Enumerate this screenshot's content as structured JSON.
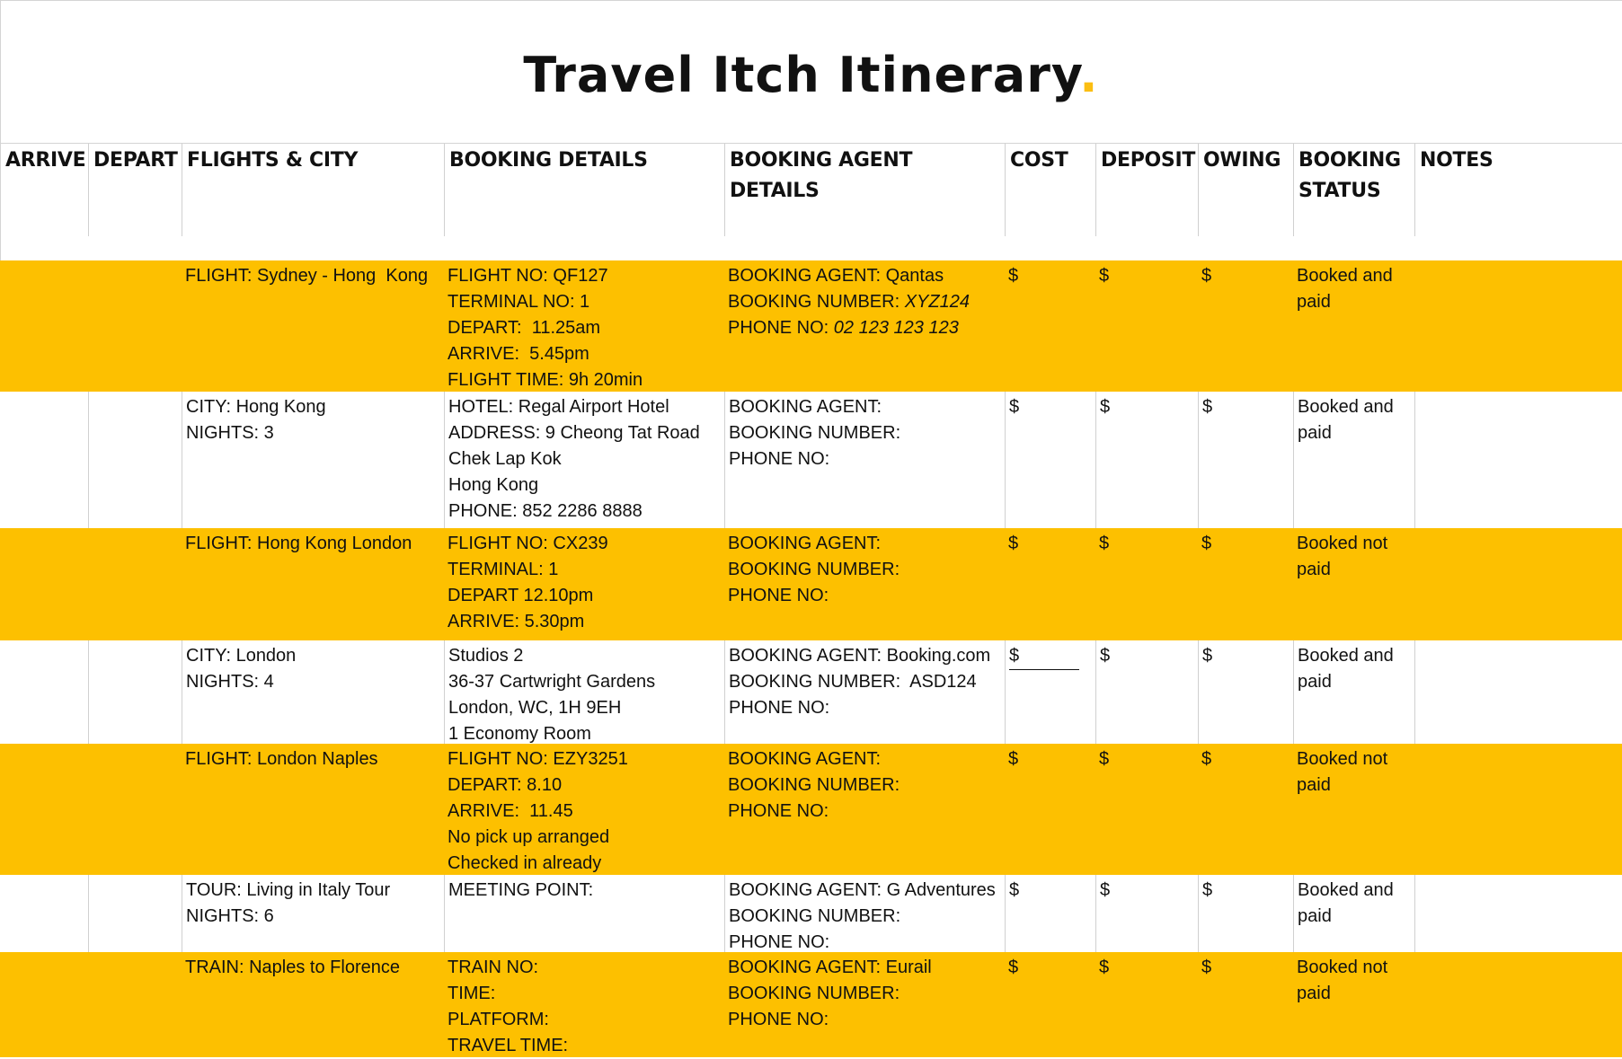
{
  "title": {
    "text": "Travel Itch Itinerary",
    "dot": ".",
    "dot_color": "#fbbe12"
  },
  "colors": {
    "row_highlight": "#fdc000",
    "grid": "#d0d0d0"
  },
  "headers": [
    {
      "key": "arrive",
      "lines": [
        "ARRIVE"
      ]
    },
    {
      "key": "depart",
      "lines": [
        "DEPART"
      ]
    },
    {
      "key": "flights_city",
      "lines": [
        "FLIGHTS & CITY"
      ]
    },
    {
      "key": "booking_details",
      "lines": [
        "BOOKING DETAILS"
      ]
    },
    {
      "key": "booking_agent",
      "lines": [
        "BOOKING AGENT",
        "DETAILS"
      ]
    },
    {
      "key": "cost",
      "lines": [
        "COST"
      ]
    },
    {
      "key": "deposit",
      "lines": [
        "DEPOSIT"
      ]
    },
    {
      "key": "owing",
      "lines": [
        "OWING"
      ]
    },
    {
      "key": "status",
      "lines": [
        "BOOKING",
        "STATUS"
      ]
    },
    {
      "key": "notes",
      "lines": [
        "NOTES"
      ]
    }
  ],
  "rows": [
    {
      "style": "orange",
      "arrive": "",
      "depart": "",
      "flights_city": [
        "FLIGHT: Sydney - Hong  Kong"
      ],
      "booking_details": [
        "FLIGHT NO: QF127",
        "TERMINAL NO: 1",
        "DEPART:  11.25am",
        "ARRIVE:  5.45pm",
        "FLIGHT TIME: 9h 20min"
      ],
      "agent": {
        "agent_label": "BOOKING AGENT:",
        "agent_value": " Qantas",
        "number_label": "BOOKING NUMBER:",
        "number_value": " XYZ124",
        "number_italic": true,
        "phone_label": "PHONE NO:",
        "phone_value": " 02 123 123 123",
        "phone_italic": true
      },
      "cost": "$",
      "deposit": "$",
      "owing": "$",
      "status": [
        "Booked and",
        "paid"
      ],
      "notes": ""
    },
    {
      "style": "white",
      "arrive": "",
      "depart": "",
      "flights_city": [
        "CITY: Hong Kong",
        "NIGHTS: 3"
      ],
      "booking_details": [
        "HOTEL: Regal Airport Hotel",
        "ADDRESS: 9 Cheong Tat Road",
        "Chek Lap Kok",
        "Hong Kong",
        "PHONE: 852 2286 8888"
      ],
      "agent": {
        "agent_label": "BOOKING AGENT:",
        "agent_value": "",
        "number_label": "BOOKING NUMBER:",
        "number_value": "",
        "number_italic": false,
        "phone_label": "PHONE NO:",
        "phone_value": "",
        "phone_italic": false
      },
      "cost": "$",
      "deposit": "$",
      "owing": "$",
      "status": [
        "Booked and",
        "paid"
      ],
      "notes": ""
    },
    {
      "style": "orange",
      "arrive": "",
      "depart": "",
      "flights_city": [
        "FLIGHT: Hong Kong London"
      ],
      "booking_details": [
        "FLIGHT NO: CX239",
        "TERMINAL: 1",
        "DEPART 12.10pm",
        "ARRIVE: 5.30pm"
      ],
      "agent": {
        "agent_label": "BOOKING AGENT:",
        "agent_value": "",
        "number_label": "BOOKING NUMBER:",
        "number_value": "",
        "number_italic": false,
        "phone_label": "PHONE NO:",
        "phone_value": "",
        "phone_italic": false
      },
      "cost": "$",
      "deposit": "$",
      "owing": "$",
      "status": [
        "Booked not",
        "paid"
      ],
      "notes": ""
    },
    {
      "style": "white",
      "arrive": "",
      "depart": "",
      "flights_city": [
        "CITY: London",
        "NIGHTS: 4"
      ],
      "booking_details": [
        "Studios 2",
        "36-37 Cartwright Gardens",
        "London, WC, 1H 9EH",
        "1 Economy Room"
      ],
      "agent": {
        "agent_label": "BOOKING AGENT:",
        "agent_value": " Booking.com",
        "number_label": "BOOKING NUMBER:",
        "number_value": "  ASD124",
        "number_italic": false,
        "phone_label": "PHONE NO:",
        "phone_value": "",
        "phone_italic": false
      },
      "cost": "$",
      "cost_underlined": true,
      "deposit": "$",
      "owing": "$",
      "status": [
        "Booked and",
        "paid"
      ],
      "notes": ""
    },
    {
      "style": "orange",
      "arrive": "",
      "depart": "",
      "flights_city": [
        "FLIGHT: London Naples"
      ],
      "booking_details": [
        "FLIGHT NO: EZY3251",
        "DEPART: 8.10",
        "ARRIVE:  11.45",
        "No pick up arranged",
        "Checked in already"
      ],
      "agent": {
        "agent_label": "BOOKING AGENT:",
        "agent_value": "",
        "number_label": "BOOKING NUMBER:",
        "number_value": "",
        "number_italic": false,
        "phone_label": "PHONE NO:",
        "phone_value": "",
        "phone_italic": false
      },
      "cost": "$",
      "deposit": "$",
      "owing": "$",
      "status": [
        "Booked not",
        "paid"
      ],
      "notes": ""
    },
    {
      "style": "white",
      "arrive": "",
      "depart": "",
      "flights_city": [
        "TOUR: Living in Italy Tour",
        "NIGHTS: 6"
      ],
      "booking_details": [
        "MEETING POINT:"
      ],
      "agent": {
        "agent_label": "BOOKING AGENT:",
        "agent_value": " G Adventures",
        "number_label": "BOOKING NUMBER:",
        "number_value": "",
        "number_italic": false,
        "phone_label": "PHONE NO:",
        "phone_value": "",
        "phone_italic": false
      },
      "cost": "$",
      "deposit": "$",
      "owing": "$",
      "status": [
        "Booked and",
        "paid"
      ],
      "notes": ""
    },
    {
      "style": "orange",
      "arrive": "",
      "depart": "",
      "flights_city": [
        "TRAIN: Naples to Florence"
      ],
      "booking_details": [
        "TRAIN NO:",
        "TIME:",
        "PLATFORM:",
        "TRAVEL TIME:"
      ],
      "agent": {
        "agent_label": "BOOKING AGENT:",
        "agent_value": " Eurail",
        "number_label": "BOOKING NUMBER:",
        "number_value": "",
        "number_italic": false,
        "phone_label": "PHONE NO:",
        "phone_value": "",
        "phone_italic": false
      },
      "cost": "$",
      "deposit": "$",
      "owing": "$",
      "status": [
        "Booked not",
        "paid"
      ],
      "notes": ""
    }
  ]
}
